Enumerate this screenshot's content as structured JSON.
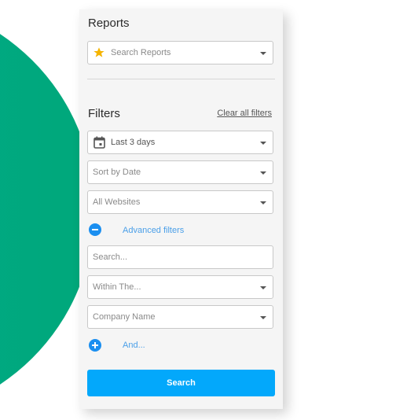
{
  "reports": {
    "title": "Reports",
    "search_placeholder": "Search Reports",
    "icon": "star-icon"
  },
  "filters": {
    "title": "Filters",
    "clear_label": "Clear all filters",
    "date_range": {
      "value": "Last 3 days",
      "icon": "calendar-icon"
    },
    "sort": {
      "value": "Sort by Date"
    },
    "websites": {
      "value": "All Websites"
    },
    "advanced_label": "Advanced filters",
    "search_placeholder": "Search...",
    "within": {
      "value": "Within The..."
    },
    "company": {
      "value": "Company Name"
    },
    "and_label": "And...",
    "search_button": "Search"
  },
  "colors": {
    "accent": "#03a8fb",
    "link": "#4a9fe8",
    "brand_green": "#00a87a",
    "star": "#f5b400"
  }
}
